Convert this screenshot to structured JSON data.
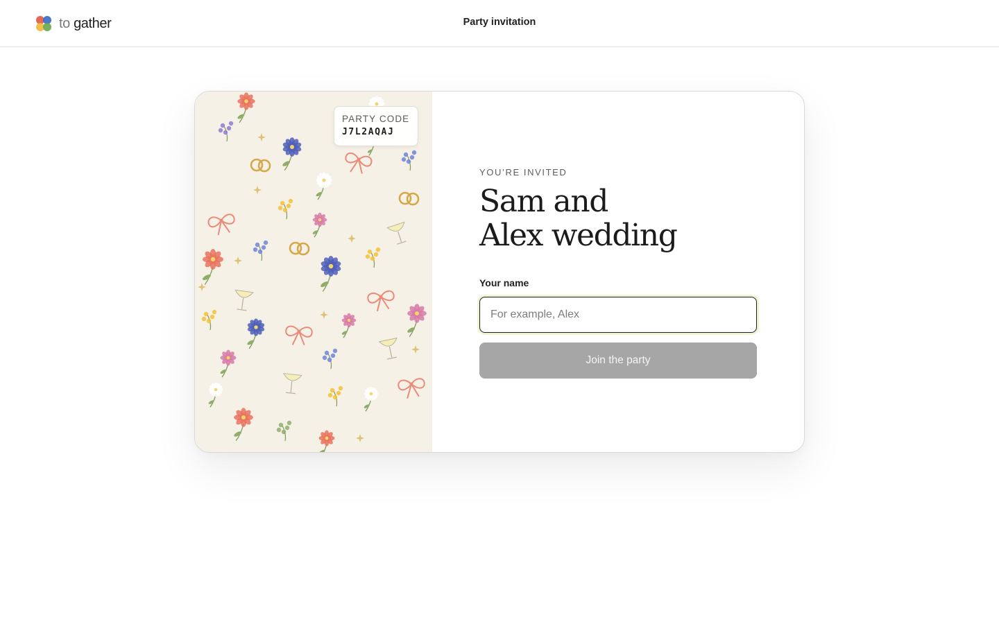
{
  "header": {
    "logo_prefix": "to",
    "logo_suffix": "gather",
    "page_title": "Party invitation",
    "logo_colors": [
      "#e05a47",
      "#3b6cc9",
      "#f3b83d",
      "#6aa84f"
    ]
  },
  "invitation": {
    "code_label": "PARTY CODE",
    "code": "J7L2AQAJ",
    "eyebrow": "YOU’RE INVITED",
    "title_line1": "Sam and",
    "title_line2": "Alex wedding"
  },
  "form": {
    "name_label": "Your name",
    "name_value": "",
    "name_placeholder": "For example, Alex",
    "join_label": "Join the party",
    "join_disabled": true
  },
  "colors": {
    "art_background": "#f6f1e7",
    "button_disabled": "#a6a6a6",
    "flower_red": "#e8735e",
    "flower_blue": "#4f5fb8",
    "flower_yellow": "#f2c236",
    "flower_pink": "#d77aa6",
    "bow": "#e98b78",
    "ring": "#d4a94a"
  }
}
